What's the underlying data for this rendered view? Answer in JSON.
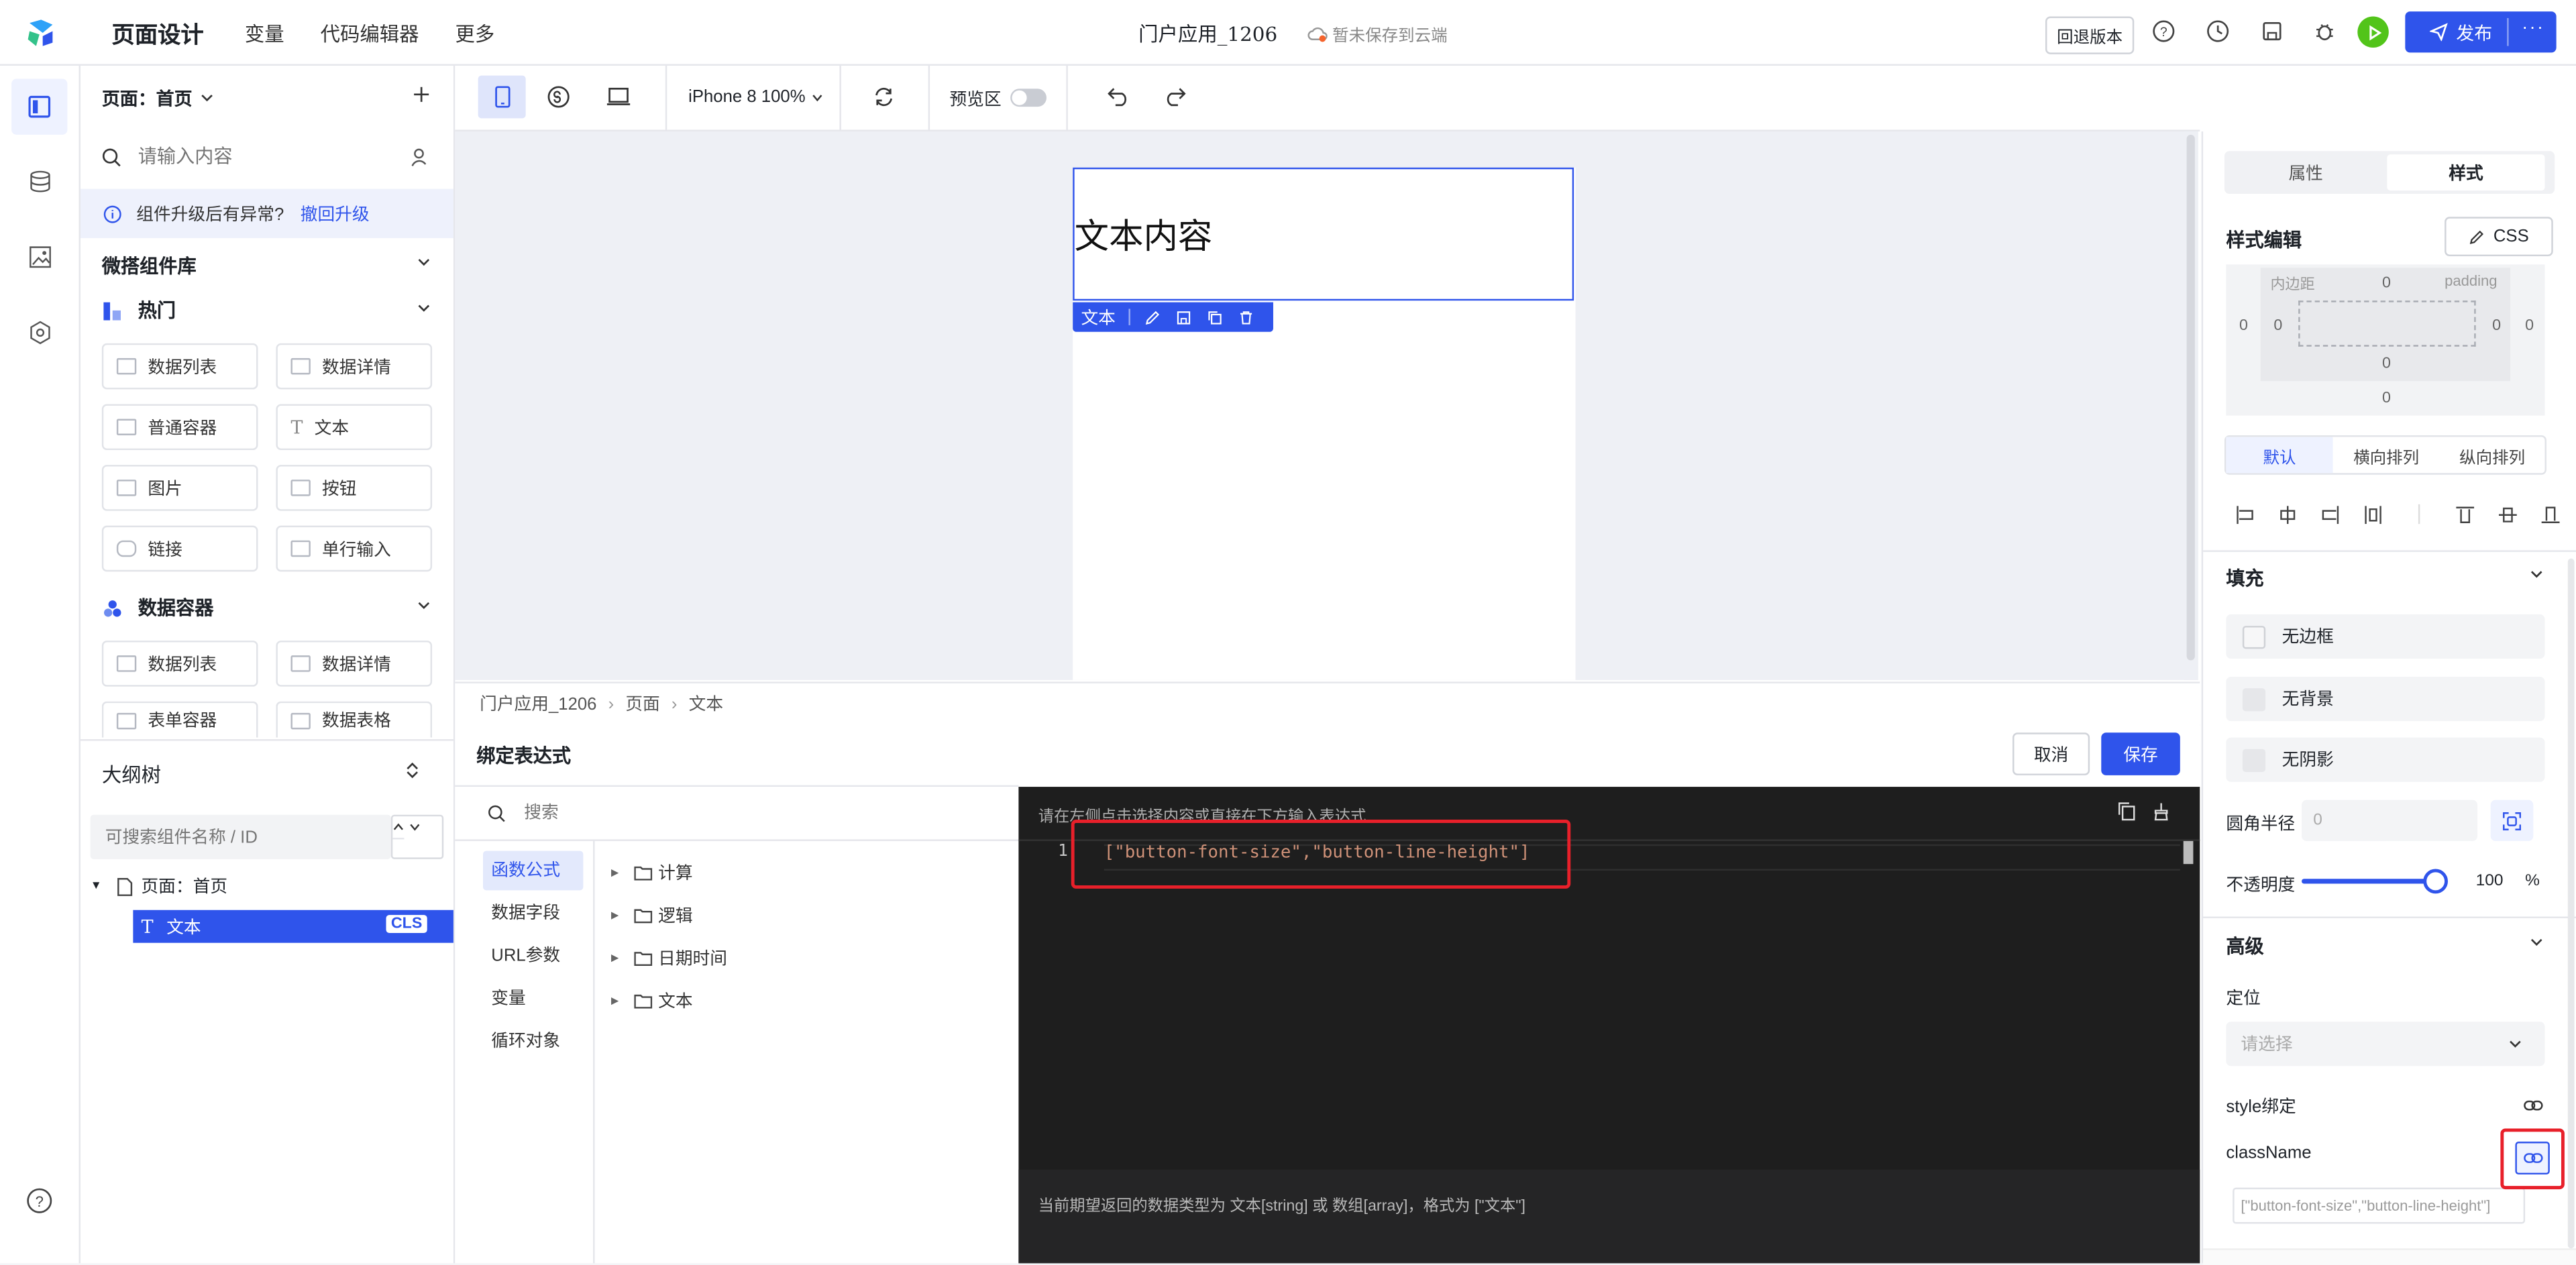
{
  "topbar": {
    "title": "页面设计",
    "nav": [
      "变量",
      "代码编辑器",
      "更多"
    ],
    "app_name": "门户应用_1206",
    "save_status": "暂未保存到云端",
    "rollback_label": "回退版本",
    "publish_label": "发布",
    "accent_color": "#2f54eb",
    "run_color": "#52c41a"
  },
  "left_panel": {
    "page_label": "页面：首页",
    "search_placeholder": "请输入内容",
    "notice_text": "组件升级后有异常?",
    "notice_link": "撤回升级",
    "library_title": "微搭组件库",
    "hot_group": "热门",
    "hot_items": [
      "数据列表",
      "数据详情",
      "普通容器",
      "文本",
      "图片",
      "按钮",
      "链接",
      "单行输入"
    ],
    "data_group": "数据容器",
    "data_items": [
      "数据列表",
      "数据详情",
      "表单容器",
      "数据表格"
    ],
    "outline_title": "大纲树",
    "outline_search_placeholder": "可搜索组件名称 / ID",
    "outline_page": "页面：首页",
    "outline_text": "文本",
    "outline_badge": "CLS"
  },
  "canvas_toolbar": {
    "device_label": "iPhone 8 100%",
    "preview_label": "预览区"
  },
  "canvas": {
    "text_content": "文本内容",
    "selection_label": "文本"
  },
  "breadcrumb": [
    "门户应用_1206",
    "页面",
    "文本"
  ],
  "bind_panel": {
    "title": "绑定表达式",
    "cancel_label": "取消",
    "save_label": "保存",
    "search_placeholder": "搜索",
    "categories": [
      "函数公式",
      "数据字段",
      "URL参数",
      "变量",
      "循环对象"
    ],
    "folders": [
      "计算",
      "逻辑",
      "日期时间",
      "文本"
    ],
    "editor_hint": "请在左侧点击选择内容或直接在下方输入表达式",
    "line_number": "1",
    "code": "[\"button-font-size\",\"button-line-height\"]",
    "footer_hint": "当前期望返回的数据类型为 文本[string] 或 数组[array]，格式为 [\"文本\"]"
  },
  "right_panel": {
    "tabs": [
      "属性",
      "样式"
    ],
    "style_edit_title": "样式编辑",
    "css_label": "CSS",
    "padding_label": "内边距",
    "padding_en": "padding",
    "box_values": {
      "margin_top": "0",
      "margin_left": "0",
      "margin_right": "0",
      "margin_bottom": "0",
      "pad_top": "0",
      "pad_left": "0",
      "pad_right": "0",
      "pad_bottom": "0"
    },
    "layout_tabs": [
      "默认",
      "横向排列",
      "纵向排列"
    ],
    "fill_title": "填充",
    "fill_items": [
      "无边框",
      "无背景",
      "无阴影"
    ],
    "radius_label": "圆角半径",
    "radius_value": "0",
    "opacity_label": "不透明度",
    "opacity_value": "100",
    "opacity_unit": "%",
    "opacity_level": 1.0,
    "advanced_title": "高级",
    "position_label": "定位",
    "position_placeholder": "请选择",
    "style_binding_label": "style绑定",
    "classname_label": "className",
    "classname_value": "[\"button-font-size\",\"button-line-height\"]"
  }
}
